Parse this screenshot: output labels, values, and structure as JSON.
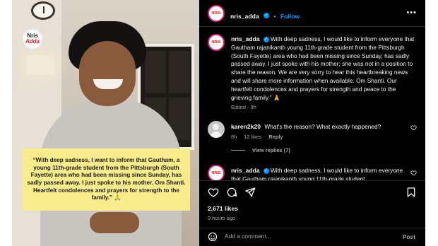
{
  "image": {
    "logo_line1": "Nris",
    "logo_line2": "Adda",
    "caption": "“With deep sadness, I want to inform that Gautham, a young 11th-grade student from the Pittsburgh (South Fayette) area who had been missing since Sunday, has sadly passed away. I just spoke to his mother. Om Shanti. Heartfelt condolences and prayers for strength to the family.” 🙏"
  },
  "header": {
    "avatar_text": "NRIS",
    "username": "nris_adda",
    "separator": "•",
    "follow_label": "Follow",
    "more_label": "•••"
  },
  "caption_comment": {
    "username": "nris_adda",
    "text": "With deep sadness, I would like to inform everyone that Gautham rajanikanth young 11th-grade student from the Pittsburgh (South Fayette) area who had been missing since Sunday, has sadly passed away. I just spoke with his mother; she was not in a position to share the reason. We are very sorry to hear this heartbreaking news and will share more information when available. Om Shanti. Our heartfelt condolences and prayers for strength and peace to the grieving family.” 🙏",
    "meta": "Edited · 9h"
  },
  "comments": [
    {
      "username": "karen2k20",
      "text": "What's the reason? What exactly happened?",
      "time": "8h",
      "likes": "12 likes",
      "reply_label": "Reply"
    },
    {
      "username": "nris_adda",
      "text": "With deep sadness, I would like to inform everyone that Gautham rajanikanth young 11th-grade student"
    }
  ],
  "view_replies_label": "View replies (7)",
  "actions": {
    "likes": "2,671 likes",
    "time_ago": "9 hours ago",
    "comment_placeholder": "Add a comment...",
    "post_label": "Post"
  },
  "colors": {
    "accent": "#0095f6",
    "caption_bg": "#f9ec8e",
    "muted": "#a8a8a8"
  }
}
